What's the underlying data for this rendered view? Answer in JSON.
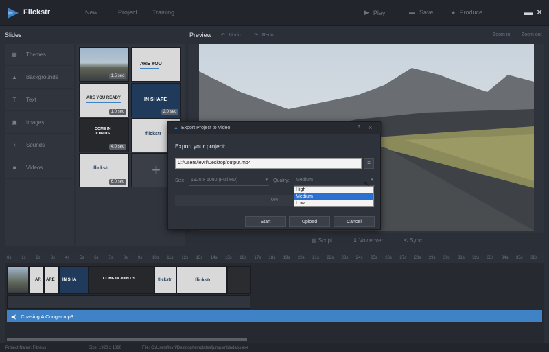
{
  "app": {
    "name": "Flickstr"
  },
  "menu": [
    "New",
    "Project",
    "Training"
  ],
  "top_actions": {
    "play": "Play",
    "save": "Save",
    "produce": "Produce"
  },
  "slides_panel": {
    "title": "Slides"
  },
  "preview": {
    "title": "Preview",
    "undo": "Undo",
    "redo": "Redo",
    "zoom_in": "Zoom in",
    "zoom_out": "Zoom out"
  },
  "categories": [
    "Themes",
    "Backgrounds",
    "Text",
    "Images",
    "Sounds",
    "Videos"
  ],
  "slides": [
    {
      "text": "",
      "duration": "1.5 sec"
    },
    {
      "text": "ARE YOU",
      "duration": ""
    },
    {
      "text": "ARE YOU READY",
      "duration": "1.0 sec"
    },
    {
      "text": "IN SHAPE",
      "duration": "2.0 sec"
    },
    {
      "text": "COME IN JOIN US",
      "duration": "4.0 sec"
    },
    {
      "text": "flickstr",
      "duration": ""
    },
    {
      "text": "flickstr",
      "duration": "6.0 sec"
    }
  ],
  "add_slide": "+",
  "under_preview": {
    "script": "Script",
    "voiceover": "Voiceover",
    "sync": "Sync"
  },
  "dialog": {
    "title": "Export Project to Video",
    "help": "?",
    "close": "×",
    "heading": "Export your project:",
    "path": "C:/Users/levri/Desktop/output.mp4",
    "size_label": "Size:",
    "size_value": "1920 x 1080 (Full HD)",
    "quality_label": "Quality:",
    "quality_value": "Medium",
    "quality_options": [
      "High",
      "Medium",
      "Low"
    ],
    "progress": "0%",
    "start": "Start",
    "upload": "Upload",
    "cancel": "Cancel"
  },
  "ruler_ticks": [
    "0s",
    "1s",
    "2s",
    "3s",
    "4s",
    "5s",
    "6s",
    "7s",
    "8s",
    "9s",
    "10s",
    "11s",
    "12s",
    "13s",
    "14s",
    "15s",
    "16s",
    "17s",
    "18s",
    "19s",
    "20s",
    "21s",
    "22s",
    "23s",
    "24s",
    "25s",
    "26s",
    "27s",
    "28s",
    "29s",
    "30s",
    "31s",
    "32s",
    "33s",
    "34s",
    "35s",
    "36s"
  ],
  "timeline_clips": [
    {
      "text": ""
    },
    {
      "text": "AR"
    },
    {
      "text": "ARE"
    },
    {
      "text": "IN SHA"
    },
    {
      "text": "COME IN JOIN US"
    },
    {
      "text": "flickstr"
    },
    {
      "text": "flickstr"
    }
  ],
  "audio": {
    "name": "Chasing A Cougar.mp3"
  },
  "status": {
    "project": "Project Name: Fitness",
    "size": "Size: 1920 x 1080",
    "file": "File: C:/Users/levri/Desktop/templates/jumpsmbindaps.exe"
  }
}
